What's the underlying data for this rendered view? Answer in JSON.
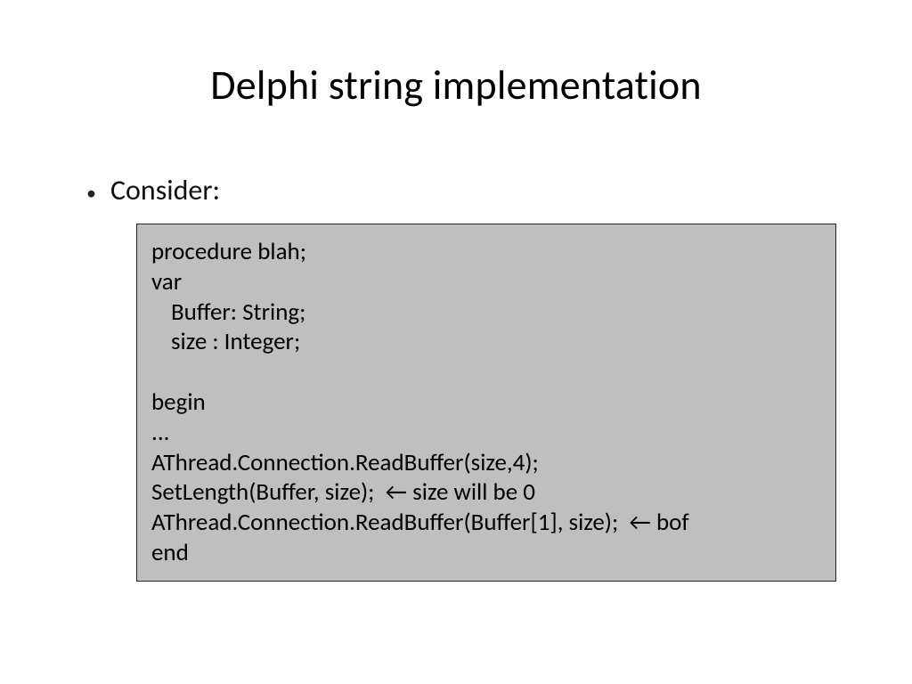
{
  "slide": {
    "title": "Delphi string implementation",
    "bullet1": "Consider:",
    "code": {
      "l1": "procedure blah;",
      "l2": "var",
      "l3": "Buffer: String;",
      "l4": "size : Integer;",
      "l6": "begin",
      "l7": "...",
      "l8": "AThread.Connection.ReadBuffer(size,4);",
      "l9": "SetLength(Buffer, size);  ← size will be 0",
      "l10": "AThread.Connection.ReadBuffer(Buffer[1], size);  ← bof",
      "l11": "end"
    }
  }
}
